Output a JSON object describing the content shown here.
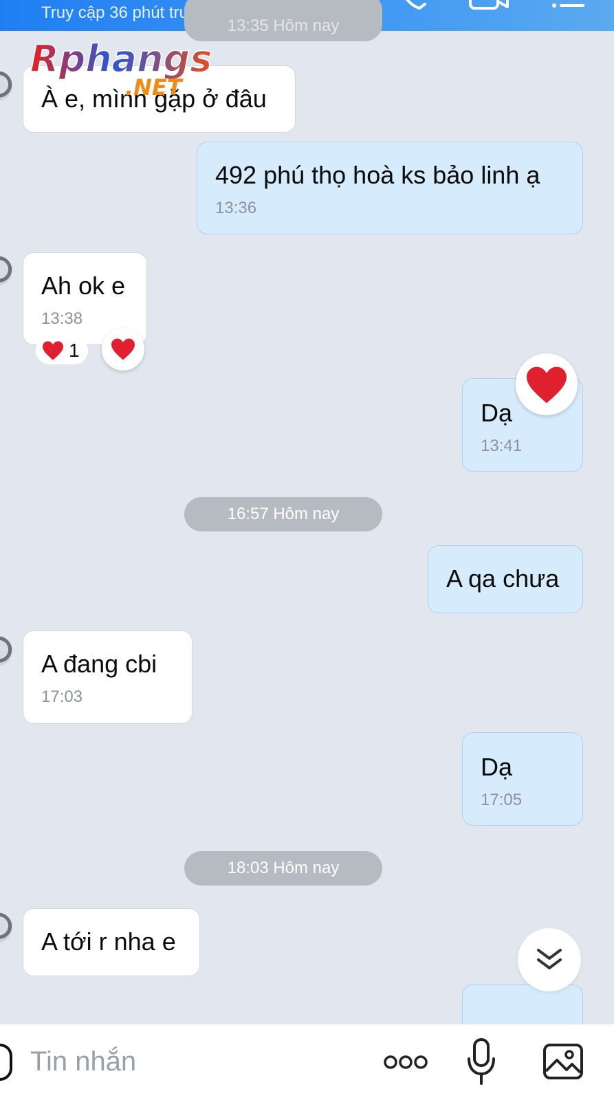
{
  "header": {
    "status": "Truy cập 36 phút trước"
  },
  "watermark": {
    "brand": "Rphangs",
    "suffix": ".NET"
  },
  "separators": [
    "13:35 Hôm nay",
    "16:57 Hôm nay",
    "18:03 Hôm nay"
  ],
  "messages": [
    {
      "dir": "in",
      "text": "À e, mình gặp ở đâu",
      "time": ""
    },
    {
      "dir": "out",
      "text": "492 phú thọ hoà ks bảo linh ạ",
      "time": "13:36"
    },
    {
      "dir": "in",
      "text": "Ah ok e",
      "time": "13:38"
    },
    {
      "dir": "out",
      "text": "Dạ",
      "time": "13:41"
    },
    {
      "dir": "out",
      "text": "A qa chưa",
      "time": ""
    },
    {
      "dir": "in",
      "text": "A đang cbi",
      "time": "17:03"
    },
    {
      "dir": "out",
      "text": "Dạ",
      "time": "17:05"
    },
    {
      "dir": "in",
      "text": "A tới r nha e",
      "time": ""
    }
  ],
  "reaction": {
    "emoji": "heart",
    "count": "1"
  },
  "composer": {
    "placeholder": "Tin nhắn"
  },
  "icons": [
    "phone-icon",
    "video-icon",
    "menu-icon",
    "heart-icon",
    "chevron-double-down-icon",
    "sticker-icon",
    "more-icon",
    "microphone-icon",
    "image-icon"
  ],
  "colors": {
    "header_start": "#1f7ff2",
    "header_end": "#5aaaf0",
    "bubble_out": "#d6ebfb",
    "bubble_in": "#ffffff",
    "background": "#e2e7ef",
    "heart": "#e0202e"
  }
}
